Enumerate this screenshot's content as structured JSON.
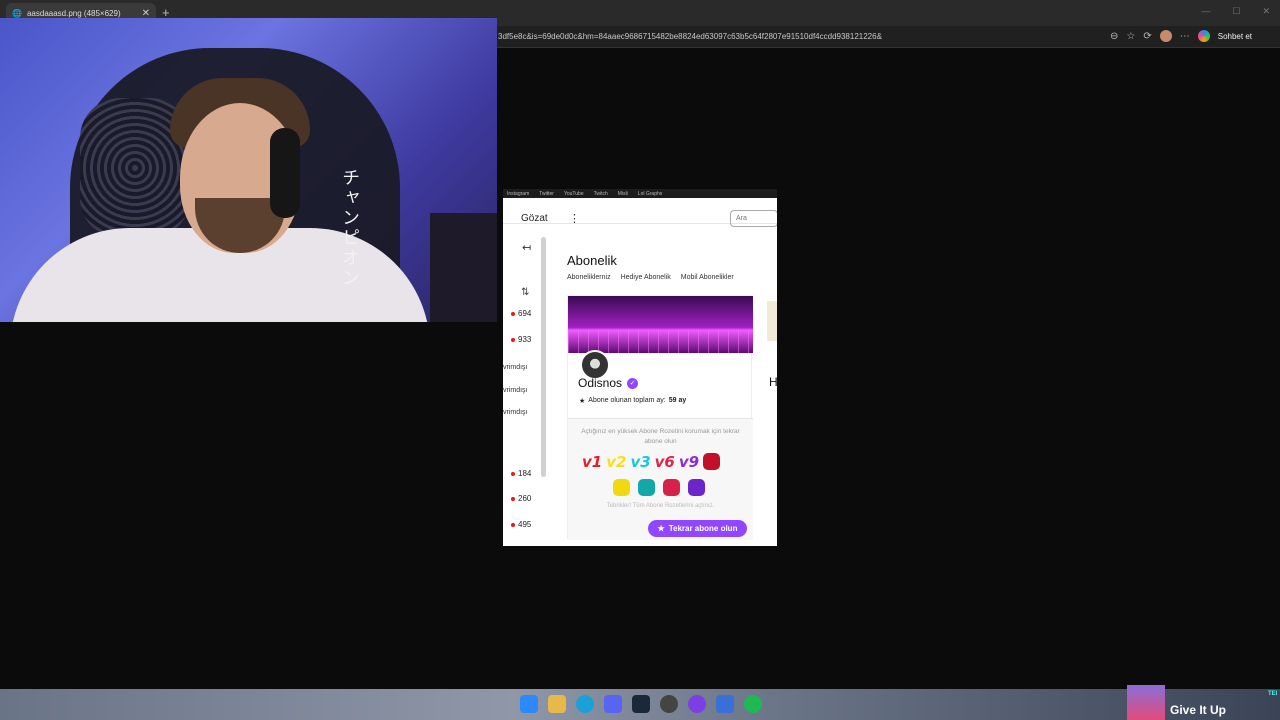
{
  "browser": {
    "tab_title": "aasdaaasd.png (485×629)",
    "tab_close": "✕",
    "new_tab": "+",
    "url": "3df5e8c&is=69de0d0c&hm=84aaec9686715482be8824ed63097c63b5c64f2807e91510df4ccdd938121226&",
    "chat_button": "Sohbet et"
  },
  "webcam": {
    "overlay_text": "チャンピオン"
  },
  "twitch": {
    "bookmarks": [
      "Instagram",
      "Twitter",
      "YouTube",
      "Twitch",
      "Misli",
      "Lol Graphs"
    ],
    "browse_label": "Gözat",
    "search_placeholder": "Ara",
    "sidebar_viewers": [
      "694",
      "933",
      "184",
      "260",
      "495"
    ],
    "sidebar_offline": [
      "vrimdışı",
      "vrimdışı",
      "vrimdışı"
    ],
    "page_title": "Abonelik",
    "subtabs": [
      "Aboneliklerniz",
      "Hediye Abonelik",
      "Mobil Abonelikler"
    ],
    "card": {
      "channel_name": "Odisnos",
      "sub_label": "Abone olunan toplam ay:",
      "sub_months": "59 ay",
      "badge_message": "Açtığınız en yüksek Abone Rozetini korumak için tekrar abone olun",
      "badge_labels": [
        "v1",
        "v2",
        "v3",
        "v6",
        "v9"
      ],
      "badge_done": "Tebrikler! Tüm Abone Rozetlerini açtınız.",
      "resub_button": "Tekrar abone olun"
    },
    "card2_initial": "H"
  },
  "taskbar": {
    "now_playing": "Give It Up",
    "side_label": "TEI"
  },
  "colors": {
    "twitch_purple": "#9147ff",
    "live_red": "#e91916"
  }
}
